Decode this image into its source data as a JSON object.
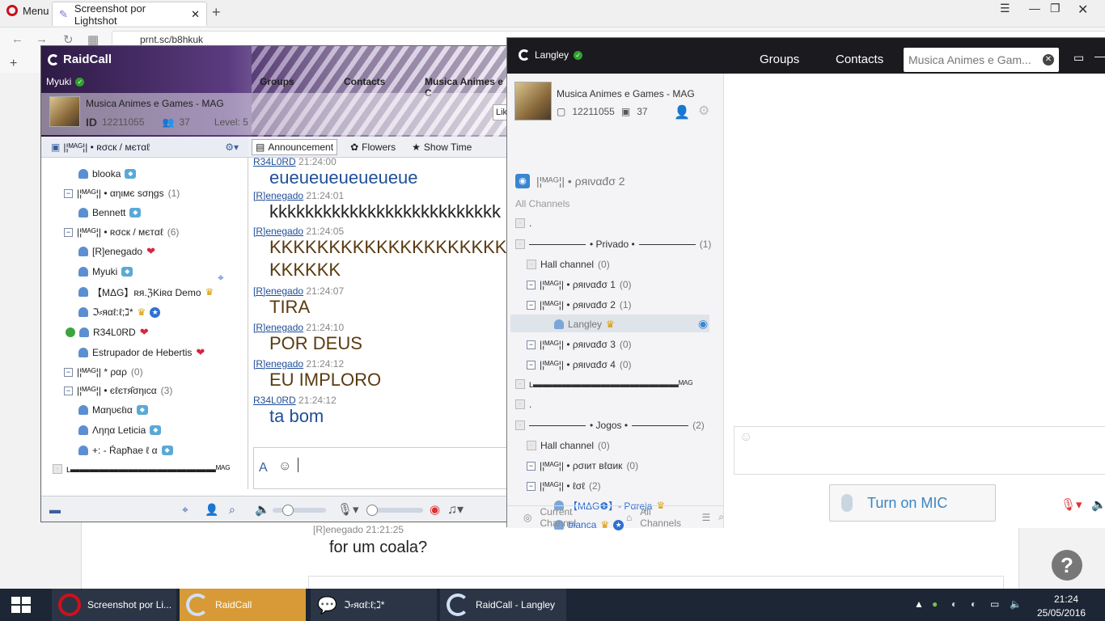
{
  "browser": {
    "menu": "Menu",
    "tab_title": "Screenshot por Lightshot",
    "address": "prnt.sc/b8hkuk"
  },
  "bg_page": {
    "msg_meta": "[R]enegado 21:21:25",
    "msg_text": "for um coala?"
  },
  "raidcall": {
    "logo": "RaidCall",
    "user": "Myuki",
    "nav": [
      "Groups",
      "Contacts",
      "Musica Animes e C"
    ],
    "group": {
      "name": "Musica Animes e Games - MAG",
      "id_label": "ID",
      "id": "12211055",
      "members": "37",
      "level": "Level: 5",
      "like": "Lik"
    },
    "current_channel": "|¦ᴹᴬᴳ¦| • ʀσcк / мєтαℓ",
    "toolbar": {
      "announcement": "Announcement",
      "flowers": "Flowers",
      "show_time": "Show Time"
    },
    "tree": [
      {
        "type": "user",
        "name": "blooka"
      },
      {
        "type": "channel",
        "name": "|¦ᴹᴬᴳ¦| • αηιмє ѕσηgѕ",
        "count": "(1)"
      },
      {
        "type": "user",
        "name": "Bennett"
      },
      {
        "type": "channel",
        "name": "|¦ᴹᴬᴳ¦| • ʀσcк / мєтαℓ",
        "count": "(6)"
      },
      {
        "type": "user",
        "name": "[R]enegado"
      },
      {
        "type": "user",
        "name": "Myuki"
      },
      {
        "type": "user",
        "name": "【MΔG】ʀя.ℨKiʀα Demo"
      },
      {
        "type": "user",
        "name": "ℑ⸗яαℓ:ℓ;ℷ*"
      },
      {
        "type": "user",
        "name": "R34L0RD"
      },
      {
        "type": "user",
        "name": "Estrupador de Hebertis"
      },
      {
        "type": "channel",
        "name": "|¦ᴹᴬᴳ¦| * ραρ",
        "count": "(0)"
      },
      {
        "type": "channel",
        "name": "|¦ᴹᴬᴳ¦| • єℓєтя̂σηιcα",
        "count": "(3)"
      },
      {
        "type": "user",
        "name": "Мαηυєℓια"
      },
      {
        "type": "user",
        "name": "Ληηα Leticia"
      },
      {
        "type": "user",
        "name": "+: - Ŕapħae ℓ α"
      },
      {
        "type": "sep",
        "name": "ʟ▬▬▬▬▬▬▬▬▬▬▬▬▬▬▬ᴹᴬᴳ"
      }
    ],
    "chat": [
      {
        "who": "R34L0RD",
        "time": "21:24:00",
        "text": "eueueueueueueue",
        "color": "#1f4f99"
      },
      {
        "who": "[R]enegado",
        "time": "21:24:01",
        "text": "kkkkkkkkkkkkkkkkkkkkkkkkkk",
        "color": "#222222"
      },
      {
        "who": "[R]enegado",
        "time": "21:24:05",
        "text": "KKKKKKKKKKKKKKKKKKKK",
        "text2": "KKKKKK",
        "color": "#5a3a10"
      },
      {
        "who": "[R]enegado",
        "time": "21:24:07",
        "text": "TIRA",
        "color": "#5a3a10"
      },
      {
        "who": "[R]enegado",
        "time": "21:24:10",
        "text": "POR DEUS",
        "color": "#5a3a10"
      },
      {
        "who": "[R]enegado",
        "time": "21:24:12",
        "text": "EU IMPLORO",
        "color": "#5a3a10"
      },
      {
        "who": "R34L0RD",
        "time": "21:24:12",
        "text": "ta bom",
        "color": "#1f4f99"
      }
    ]
  },
  "langley": {
    "user": "Langley",
    "nav": [
      "Groups",
      "Contacts"
    ],
    "tab": "Musica Animes e Gam...",
    "group": {
      "name": "Musica Animes e Games - MAG",
      "id": "12211055",
      "members": "37"
    },
    "channel": "|¦ᴹᴬᴳ¦| • ρяιναđσ 2",
    "all_channels": "All Channels",
    "tree": [
      {
        "indent": 0,
        "kind": "sq",
        "name": "."
      },
      {
        "indent": 0,
        "kind": "sq",
        "name": "• Privado •",
        "count": "(1)",
        "rule": true
      },
      {
        "indent": 1,
        "kind": "sq",
        "name": "Hall channel",
        "count": "(0)"
      },
      {
        "indent": 1,
        "kind": "minus",
        "name": "|¦ᴹᴬᴳ¦| • ρяιναđσ 1",
        "count": "(0)"
      },
      {
        "indent": 1,
        "kind": "minus",
        "name": "|¦ᴹᴬᴳ¦| • ρяιναđσ 2",
        "count": "(1)"
      },
      {
        "indent": 2,
        "kind": "user",
        "name": "Langley"
      },
      {
        "indent": 1,
        "kind": "minus",
        "name": "|¦ᴹᴬᴳ¦| • ρяιναđσ 3",
        "count": "(0)"
      },
      {
        "indent": 1,
        "kind": "minus",
        "name": "|¦ᴹᴬᴳ¦| • ρяιναđσ 4",
        "count": "(0)"
      },
      {
        "indent": 0,
        "kind": "sq",
        "name": "ʟ▬▬▬▬▬▬▬▬▬▬▬▬▬▬▬ᴹᴬᴳ"
      },
      {
        "indent": 0,
        "kind": "sq",
        "name": "."
      },
      {
        "indent": 0,
        "kind": "sq",
        "name": "• Jogos •",
        "count": "(2)",
        "rule": true
      },
      {
        "indent": 1,
        "kind": "sq",
        "name": "Hall channel",
        "count": "(0)"
      },
      {
        "indent": 1,
        "kind": "minus",
        "name": "|¦ᴹᴬᴳ¦| • ρσιит вℓαик",
        "count": "(0)"
      },
      {
        "indent": 1,
        "kind": "minus",
        "name": "|¦ᴹᴬᴳ¦| • ℓσℓ",
        "count": "(2)"
      },
      {
        "indent": 2,
        "kind": "user",
        "name": "【MΔG❶】- Pαreja"
      },
      {
        "indent": 2,
        "kind": "user",
        "name": "bianca"
      }
    ],
    "bottom": {
      "current": "Current Channel",
      "all": "All Channels"
    },
    "mic": "Turn on MIC"
  },
  "taskbar": {
    "items": [
      "Screenshot por Li...",
      "RaidCall",
      "ℑ⸗яαℓ:ℓ;ℷ*",
      "RaidCall - Langley"
    ],
    "time": "21:24",
    "date": "25/05/2016"
  }
}
